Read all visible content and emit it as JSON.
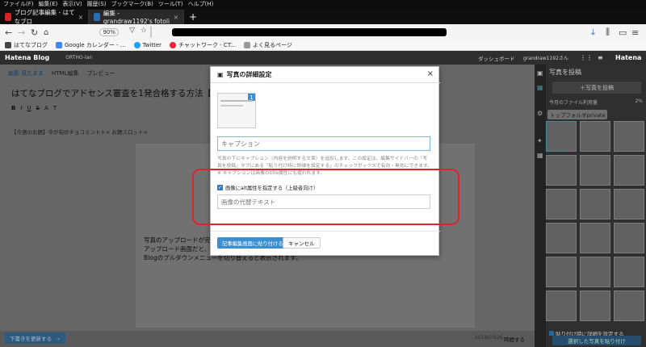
{
  "browser": {
    "menu": [
      "ファイル(F)",
      "編集(E)",
      "表示(V)",
      "履歴(S)",
      "ブックマーク(B)",
      "ツール(T)",
      "ヘルプ(H)"
    ],
    "tabs": [
      {
        "label": "ブログ記事編集 - はてなブロ",
        "active": false,
        "color": "#d9232a"
      },
      {
        "label": "編集 - grandraw1192's fotoli",
        "active": true,
        "color": "#2b6fb5"
      }
    ],
    "zoom": "90%",
    "bookmarks": [
      "はてなブログ",
      "Google カレンダー - ...",
      "Twitter",
      "チャットワーク - CT...",
      "よく見るページ"
    ]
  },
  "hatena": {
    "logo": "Hatena Blog",
    "blog_label": "ORTHO-lan",
    "dashboard": "ダッシュボード",
    "user": "grandraw1192さん",
    "brand": "Hatena"
  },
  "editor": {
    "tabs": [
      "編集 見たまま",
      "HTML編集",
      "プレビュー"
    ],
    "title": "はてなブログでアドセンス審査を1発合格する方法【記事作成編】",
    "toolbar": [
      "B",
      "I",
      "U",
      "S",
      "A",
      "T"
    ],
    "tags": "【今週のお題】今が旬のチョコミントト×   お題スロット×",
    "body_lines": [
      "写真のアップロードが完了",
      "アップロード画面だと、プ",
      "Blogのプルダウンメニューを切り替えると表示されます。"
    ],
    "draft_button": "下書きを更新する",
    "date": "2019/03/26",
    "publish": "時間する"
  },
  "sidebar": {
    "title": "写真を投稿",
    "upload_button": "写真を投稿",
    "usage_label": "今月のファイル利用量",
    "usage_value": "2%",
    "folder": "トップフォルダprivate",
    "pick_label": "貼り付け時に詳細を設定する",
    "insert_button": "選択した写真を貼り付け"
  },
  "modal": {
    "title": "写真の詳細設定",
    "badge": "1",
    "caption_placeholder": "キャプション",
    "help_text": "写真の下にキャプション（内容を説明する文章）を追加します。この設定は、編集サイドバーの「写真を投稿」タブにある「貼り付け時に詳細を設定する」のチェックボックスで有効・無効にできます。※ キャプションは画像のtitle属性にも使われます。",
    "alt_checkbox_label": "画像にalt属性を指定する（上級者向け）",
    "alt_placeholder": "画像の代替テキスト",
    "paste_button": "記事編集画面に貼り付ける",
    "cancel_button": "キャンセル"
  },
  "colors": {
    "accent": "#3a8fd0",
    "highlight": "#e0222a"
  }
}
